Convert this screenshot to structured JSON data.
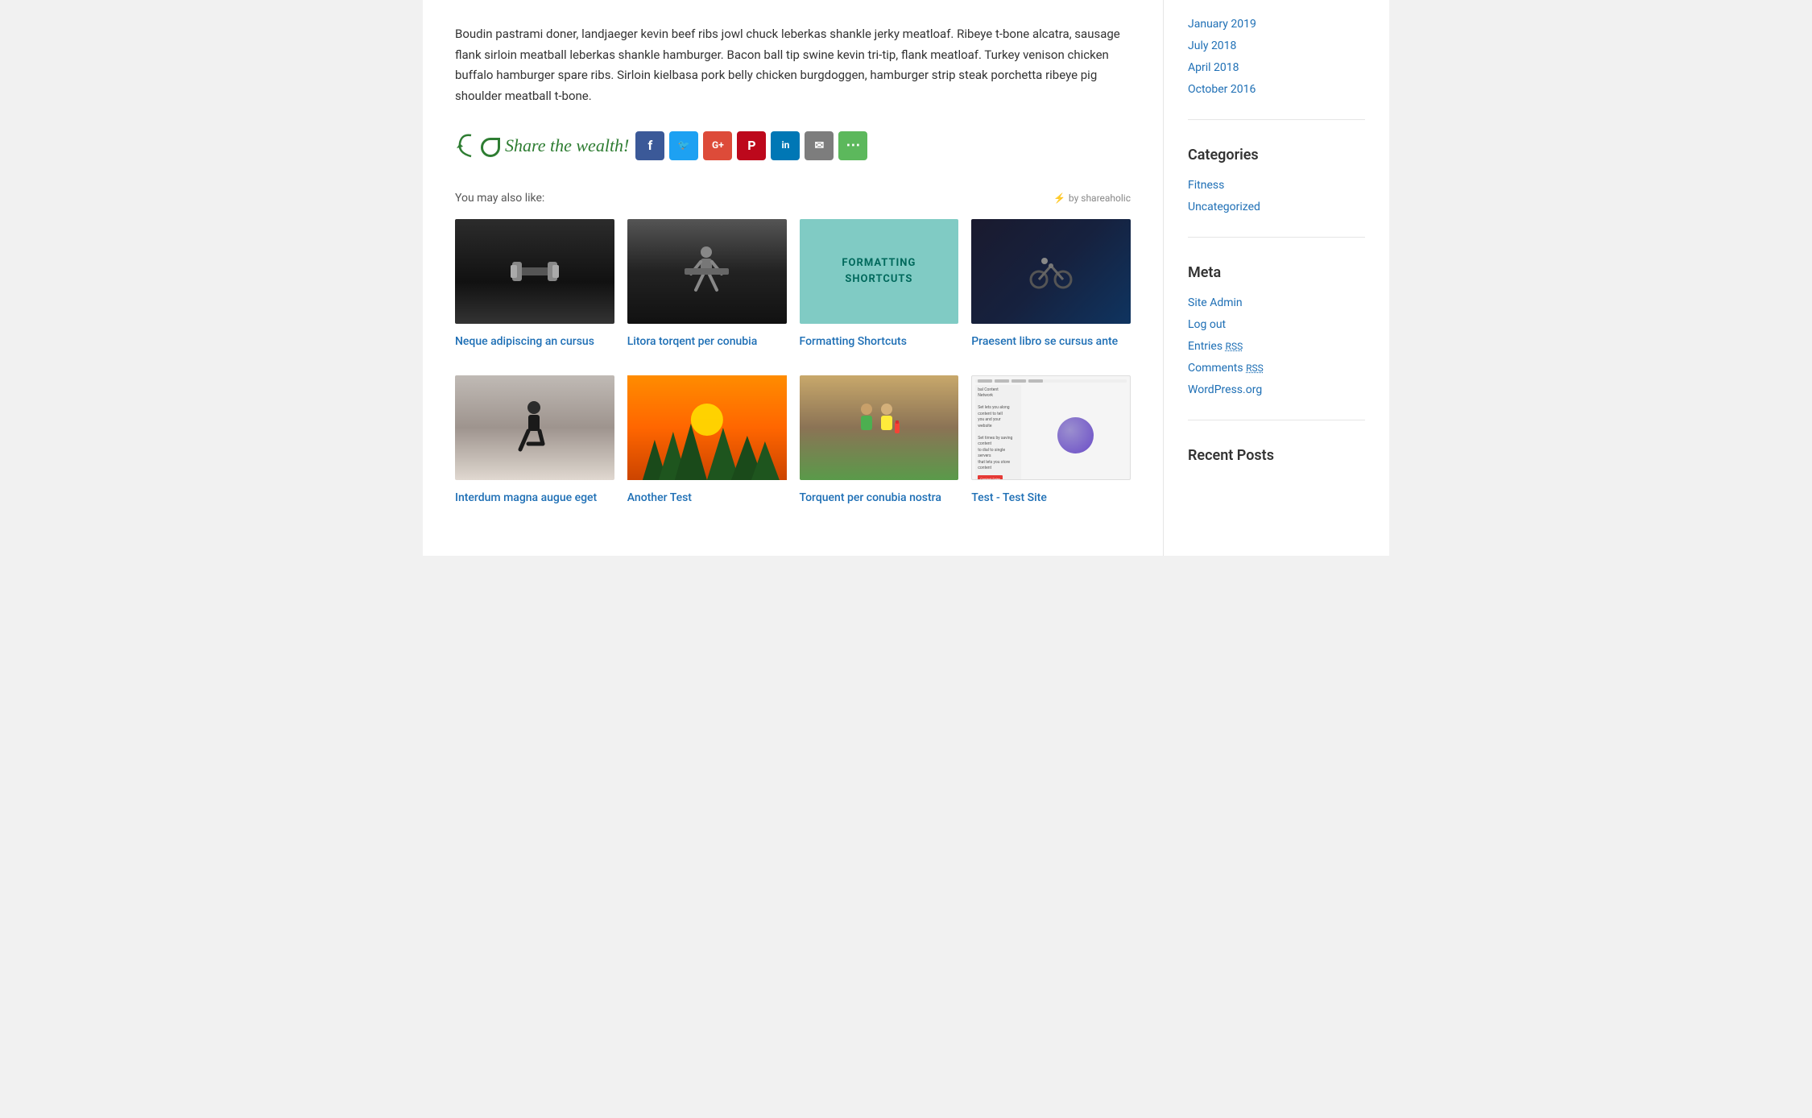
{
  "body_text": "Boudin pastrami doner, landjaeger kevin beef ribs jowl chuck leberkas shankle jerky meatloaf. Ribeye t-bone alcatra, sausage flank sirloin meatball leberkas shankle hamburger. Bacon ball tip swine kevin tri-tip, flank meatloaf. Turkey venison chicken buffalo hamburger spare ribs. Sirloin kielbasa pork belly chicken burgdoggen, hamburger strip steak porchetta ribeye pig shoulder meatball t-bone.",
  "share": {
    "label": "Share the wealth!",
    "buttons": [
      {
        "name": "facebook",
        "symbol": "f",
        "class": "facebook"
      },
      {
        "name": "twitter",
        "symbol": "t",
        "class": "twitter"
      },
      {
        "name": "google-plus",
        "symbol": "G+",
        "class": "google"
      },
      {
        "name": "pinterest",
        "symbol": "P",
        "class": "pinterest"
      },
      {
        "name": "linkedin",
        "symbol": "in",
        "class": "linkedin"
      },
      {
        "name": "email",
        "symbol": "✉",
        "class": "email"
      },
      {
        "name": "more",
        "symbol": "⋯",
        "class": "more"
      }
    ]
  },
  "also_like": {
    "label": "You may also like:",
    "credit": "by shareaholic"
  },
  "related_posts": [
    {
      "title": "Neque adipiscing an cursus",
      "img_type": "gym-weights"
    },
    {
      "title": "Litora torqent per conubia",
      "img_type": "gym-squat"
    },
    {
      "title": "Formatting Shortcuts",
      "img_type": "placeholder-teal",
      "placeholder_text": "FORMATTING SHORTCUTS"
    },
    {
      "title": "Praesent libro se cursus ante",
      "img_type": "gym-dark"
    },
    {
      "title": "Interdum magna augue eget",
      "img_type": "gym-sitting"
    },
    {
      "title": "Another Test",
      "img_type": "forest-sunset"
    },
    {
      "title": "Torquent per conubia nostra",
      "img_type": "people-gym"
    },
    {
      "title": "Test - Test Site",
      "img_type": "website-screenshot"
    }
  ],
  "sidebar": {
    "archives": {
      "heading": "",
      "links": [
        {
          "label": "January 2019",
          "href": "#"
        },
        {
          "label": "July 2018",
          "href": "#"
        },
        {
          "label": "April 2018",
          "href": "#"
        },
        {
          "label": "October 2016",
          "href": "#"
        }
      ]
    },
    "categories": {
      "heading": "Categories",
      "links": [
        {
          "label": "Fitness",
          "href": "#"
        },
        {
          "label": "Uncategorized",
          "href": "#"
        }
      ]
    },
    "meta": {
      "heading": "Meta",
      "links": [
        {
          "label": "Site Admin",
          "href": "#"
        },
        {
          "label": "Log out",
          "href": "#"
        },
        {
          "label": "Entries RSS",
          "href": "#"
        },
        {
          "label": "Comments RSS",
          "href": "#"
        },
        {
          "label": "WordPress.org",
          "href": "#"
        }
      ]
    },
    "recent_posts": {
      "heading": "Recent Posts"
    }
  }
}
